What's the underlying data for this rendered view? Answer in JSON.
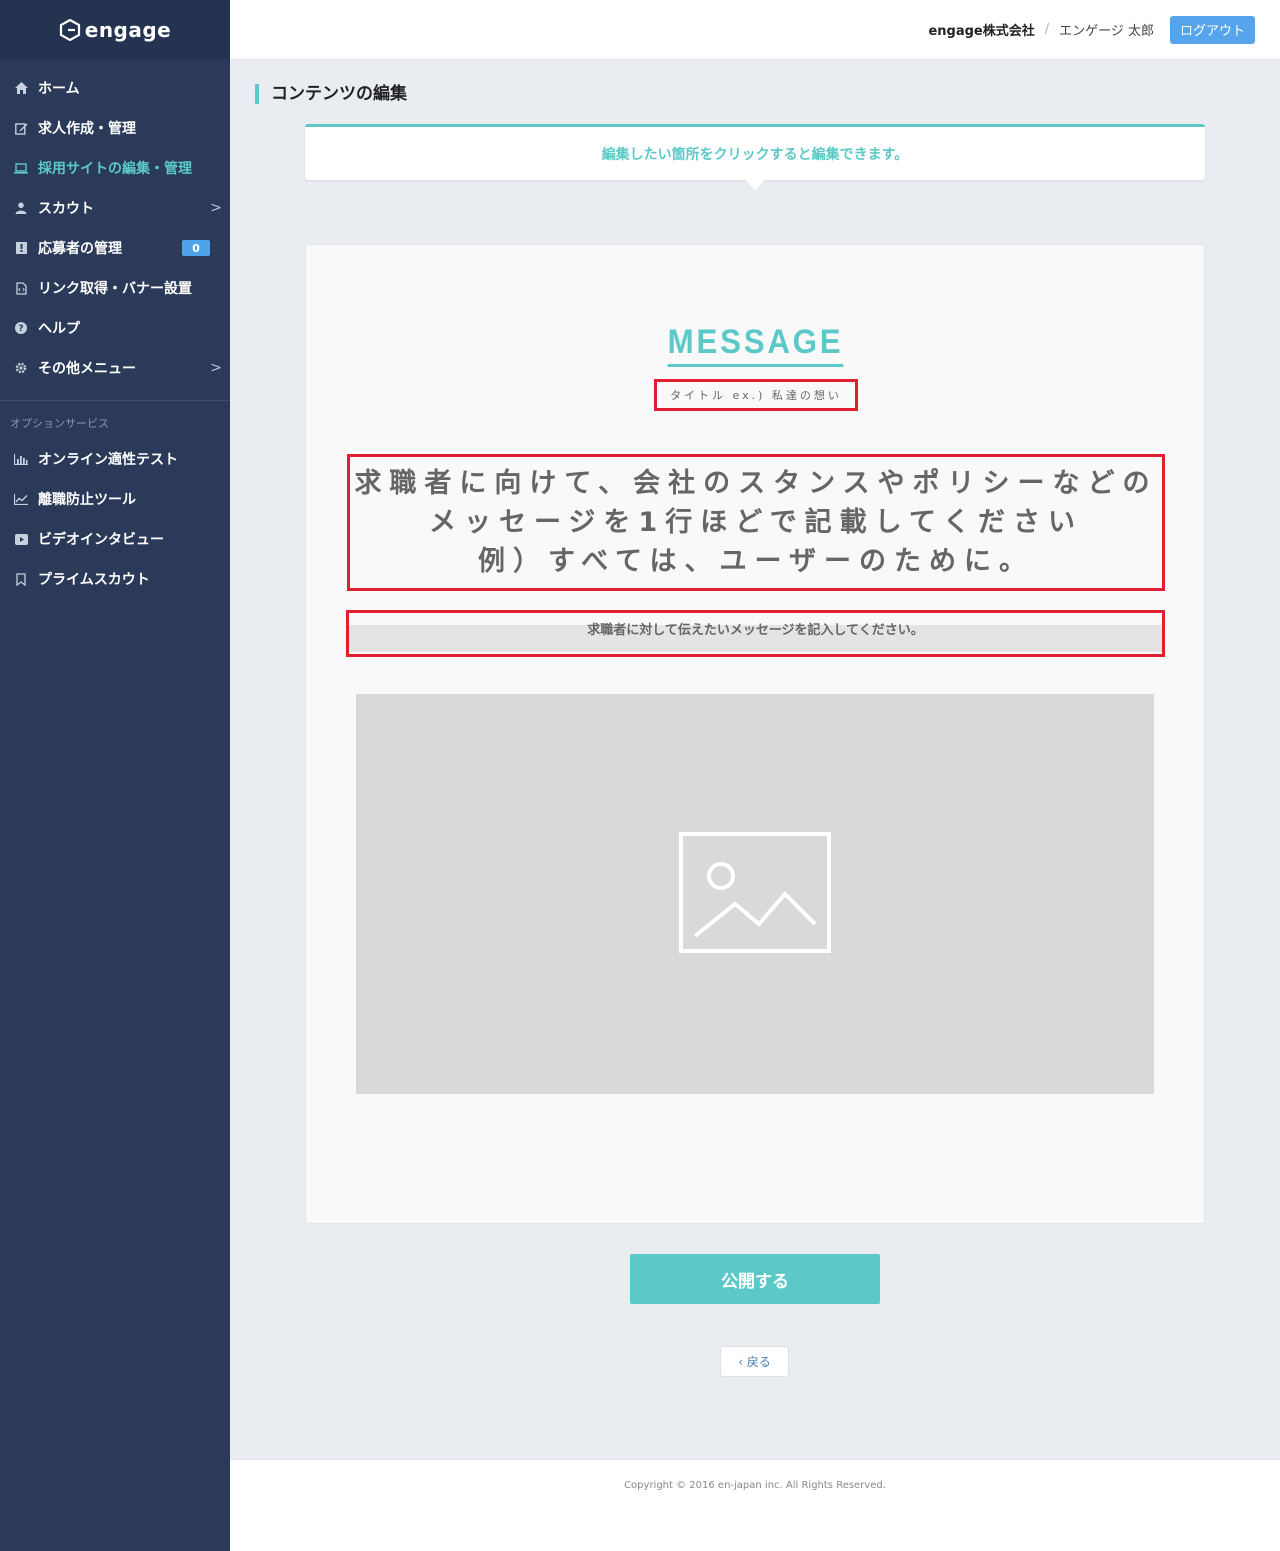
{
  "app": {
    "logo_text": "engage"
  },
  "sidebar": {
    "items": [
      {
        "label": "ホーム",
        "icon": "home-icon"
      },
      {
        "label": "求人作成・管理",
        "icon": "edit-icon"
      },
      {
        "label": "採用サイトの編集・管理",
        "icon": "laptop-icon",
        "active": true
      },
      {
        "label": "スカウト",
        "icon": "user-icon",
        "chevron": ">"
      },
      {
        "label": "応募者の管理",
        "icon": "applicants-icon",
        "badge": "0"
      },
      {
        "label": "リンク取得・バナー設置",
        "icon": "code-file-icon"
      },
      {
        "label": "ヘルプ",
        "icon": "question-icon"
      },
      {
        "label": "その他メニュー",
        "icon": "gear-icon",
        "chevron": ">"
      }
    ],
    "section_label": "オプションサービス",
    "option_items": [
      {
        "label": "オンライン適性テスト",
        "icon": "bar-chart-icon"
      },
      {
        "label": "離職防止ツール",
        "icon": "line-chart-icon"
      },
      {
        "label": "ビデオインタビュー",
        "icon": "video-icon"
      },
      {
        "label": "プライムスカウト",
        "icon": "bookmark-icon"
      }
    ]
  },
  "header": {
    "company": "engage株式会社",
    "separator": "/",
    "user": "エンゲージ 太郎",
    "logout_label": "ログアウト"
  },
  "page": {
    "title": "コンテンツの編集",
    "notice": "編集したい箇所をクリックすると編集できます。"
  },
  "editor": {
    "heading": "MESSAGE",
    "subtitle": "タイトル ex.) 私達の想い",
    "lead_lines": [
      "求職者に向けて、会社のスタンスやポリシーなどの",
      "メッセージを1行ほどで記載してください",
      "例）すべては、ユーザーのために。"
    ],
    "body_placeholder": "求職者に対して伝えたいメッセージを記入してください。",
    "image_icon": "image-placeholder-icon"
  },
  "actions": {
    "publish_label": "公開する",
    "back_label": "‹ 戻る"
  },
  "footer": {
    "copyright": "Copyright © 2016 en-japan inc. All Rights Reserved."
  },
  "colors": {
    "sidebar_bg": "#2a3a58",
    "accent": "#5cc9c8",
    "logout_bg": "#56a4ec",
    "highlight_border": "#e02030"
  }
}
